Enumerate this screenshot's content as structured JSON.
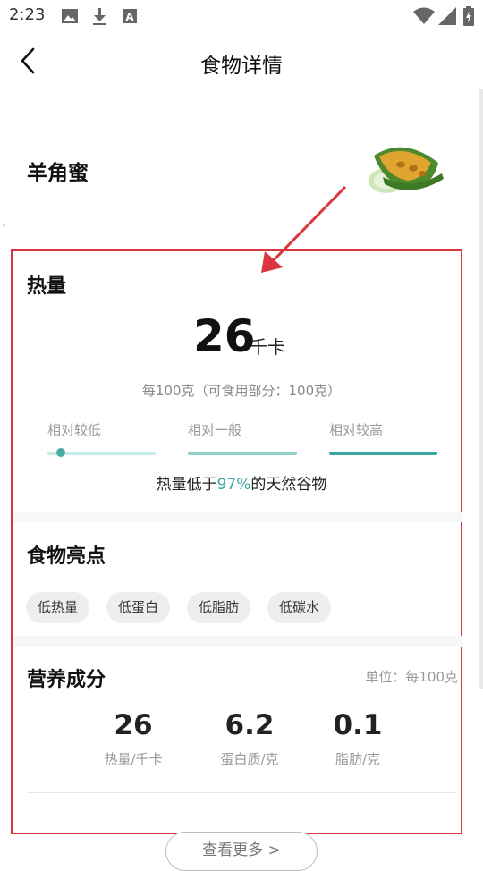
{
  "status_bar": {
    "time": "2:23",
    "icons": [
      "image-icon",
      "download-icon",
      "font-icon",
      "wifi-icon",
      "signal-icon",
      "battery-icon"
    ]
  },
  "header": {
    "title": "食物详情",
    "back_icon": "chevron-left-icon"
  },
  "food": {
    "name": "羊角蜜",
    "image": "melon-icon",
    "mark": "`"
  },
  "calories": {
    "section_title": "热量",
    "value": "26",
    "unit": "千卡",
    "per_note": "每100克（可食用部分：100克）",
    "levels": [
      "相对较低",
      "相对一般",
      "相对较高"
    ],
    "level_colors": [
      "#c7ebe8",
      "#8fd0ca",
      "#3aa79e"
    ],
    "current_level_index": 0,
    "compare_prefix": "热量低于",
    "compare_percent": "97%",
    "compare_suffix": "的天然谷物"
  },
  "highlights": {
    "section_title": "食物亮点",
    "tags": [
      "低热量",
      "低蛋白",
      "低脂肪",
      "低碳水"
    ]
  },
  "nutrition": {
    "section_title": "营养成分",
    "unit_note": "单位：每100克",
    "items": [
      {
        "value": "26",
        "label": "热量/千卡"
      },
      {
        "value": "6.2",
        "label": "蛋白质/克"
      },
      {
        "value": "0.1",
        "label": "脂肪/克"
      }
    ]
  },
  "more_button": "查看更多 >",
  "accent_color": "#3aa79e",
  "annotation_color": "#d9363e"
}
